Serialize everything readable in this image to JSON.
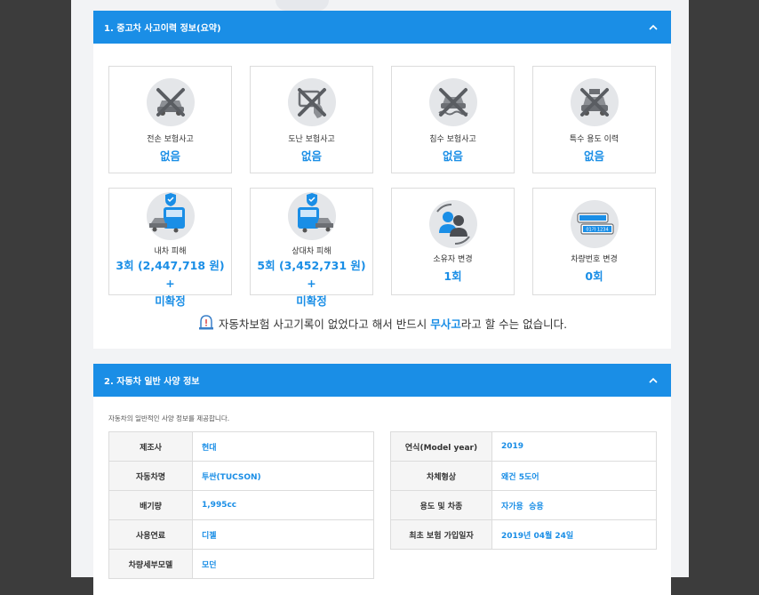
{
  "section1": {
    "title": "1. 중고차 사고이력 정보(요약)",
    "cards": [
      {
        "label": "전손 보험사고",
        "value": "없음",
        "icon": "total-loss-icon"
      },
      {
        "label": "도난 보험사고",
        "value": "없음",
        "icon": "theft-icon"
      },
      {
        "label": "침수 보험사고",
        "value": "없음",
        "icon": "flood-icon"
      },
      {
        "label": "특수 용도 이력",
        "value": "없음",
        "icon": "special-use-icon"
      },
      {
        "label": "내차 피해",
        "value_line1": "3회 (2,447,718 원) +",
        "value_line2": "미확정",
        "icon": "own-damage-icon"
      },
      {
        "label": "상대차 피해",
        "value_line1": "5회 (3,452,731 원) +",
        "value_line2": "미확정",
        "icon": "other-damage-icon"
      },
      {
        "label": "소유자 변경",
        "value": "1회",
        "icon": "owner-change-icon"
      },
      {
        "label": "차량번호 변경",
        "value": "0회",
        "icon": "plate-change-icon"
      }
    ],
    "notice_pre": "자동차보험 사고기록이 없었다고 해서 반드시 ",
    "notice_bold": "무사고",
    "notice_post": "라고 할 수는 없습니다.",
    "plate_text": "01가 1234"
  },
  "section2": {
    "title": "2. 자동차 일반 사양 정보",
    "desc": "자동차의 일반적인 사양 정보를 제공합니다.",
    "left": [
      {
        "k": "제조사",
        "v": "현대"
      },
      {
        "k": "자동차명",
        "v": "투싼(TUCSON)"
      },
      {
        "k": "배기량",
        "v": "1,995cc"
      },
      {
        "k": "사용연료",
        "v": "디젤"
      },
      {
        "k": "차량세부모델",
        "v": "모던"
      }
    ],
    "right": [
      {
        "k": "연식(Model year)",
        "v": "2019"
      },
      {
        "k": "차체형상",
        "v": "왜건 5도어"
      },
      {
        "k": "용도 및 차종",
        "v": "자가용  승용"
      },
      {
        "k": "최초 보험 가입일자",
        "v": "2019년 04월 24일"
      }
    ]
  },
  "colors": {
    "accent": "#1a8ee6",
    "background": "#3c3c3c",
    "card_border": "#dcdcdc"
  }
}
